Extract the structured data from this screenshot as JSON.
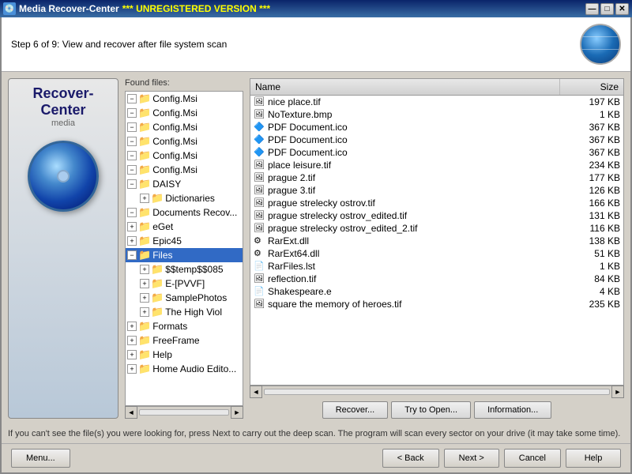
{
  "titleBar": {
    "icon": "💿",
    "appName": "Media Recover-Center",
    "unregistered": "*** UNREGISTERED VERSION ***",
    "minBtn": "—",
    "maxBtn": "□",
    "closeBtn": "✕"
  },
  "stepHeader": {
    "text": "Step 6 of 9: View and recover after file system scan"
  },
  "sidebar": {
    "logoLine1": "Recover-Center",
    "logoLine2": "media"
  },
  "foundFiles": {
    "label": "Found files:"
  },
  "treeItems": [
    {
      "indent": 0,
      "expanded": true,
      "label": "Config.Msi",
      "type": "folder-yellow"
    },
    {
      "indent": 0,
      "expanded": true,
      "label": "Config.Msi",
      "type": "folder-yellow"
    },
    {
      "indent": 0,
      "expanded": true,
      "label": "Config.Msi",
      "type": "folder-yellow"
    },
    {
      "indent": 0,
      "expanded": true,
      "label": "Config.Msi",
      "type": "folder-yellow"
    },
    {
      "indent": 0,
      "expanded": true,
      "label": "Config.Msi",
      "type": "folder-yellow"
    },
    {
      "indent": 0,
      "expanded": true,
      "label": "Config.Msi",
      "type": "folder-yellow"
    },
    {
      "indent": 0,
      "expanded": true,
      "label": "DAISY",
      "type": "folder-yellow"
    },
    {
      "indent": 1,
      "expanded": false,
      "label": "Dictionaries",
      "type": "folder-yellow"
    },
    {
      "indent": 0,
      "expanded": true,
      "label": "Documents Recov...",
      "type": "folder-yellow"
    },
    {
      "indent": 0,
      "expanded": false,
      "label": "eGet",
      "type": "folder-yellow"
    },
    {
      "indent": 0,
      "expanded": false,
      "label": "Epic45",
      "type": "folder-yellow"
    },
    {
      "indent": 0,
      "expanded": true,
      "label": "Files",
      "type": "folder-yellow",
      "selected": true
    },
    {
      "indent": 1,
      "expanded": false,
      "label": "$$temp$$085",
      "type": "folder-yellow"
    },
    {
      "indent": 1,
      "expanded": false,
      "label": "E-[PVVF]",
      "type": "folder-yellow"
    },
    {
      "indent": 1,
      "expanded": false,
      "label": "SamplePhotos",
      "type": "folder-yellow"
    },
    {
      "indent": 1,
      "expanded": false,
      "label": "The High Viol",
      "type": "folder-yellow"
    },
    {
      "indent": 0,
      "expanded": false,
      "label": "Formats",
      "type": "folder-yellow"
    },
    {
      "indent": 0,
      "expanded": false,
      "label": "FreeFrame",
      "type": "folder-yellow"
    },
    {
      "indent": 0,
      "expanded": false,
      "label": "Help",
      "type": "folder-yellow"
    },
    {
      "indent": 0,
      "expanded": false,
      "label": "Home Audio Edito...",
      "type": "folder-yellow"
    }
  ],
  "fileColumns": {
    "name": "Name",
    "size": "Size"
  },
  "files": [
    {
      "name": "nice place.tif",
      "size": "197 KB",
      "type": "tif"
    },
    {
      "name": "NoTexture.bmp",
      "size": "1 KB",
      "type": "bmp"
    },
    {
      "name": "PDF Document.ico",
      "size": "367 KB",
      "type": "ico"
    },
    {
      "name": "PDF Document.ico",
      "size": "367 KB",
      "type": "ico"
    },
    {
      "name": "PDF Document.ico",
      "size": "367 KB",
      "type": "ico"
    },
    {
      "name": "place leisure.tif",
      "size": "234 KB",
      "type": "tif"
    },
    {
      "name": "prague 2.tif",
      "size": "177 KB",
      "type": "tif"
    },
    {
      "name": "prague 3.tif",
      "size": "126 KB",
      "type": "tif"
    },
    {
      "name": "prague strelecky ostrov.tif",
      "size": "166 KB",
      "type": "tif"
    },
    {
      "name": "prague strelecky ostrov_edited.tif",
      "size": "131 KB",
      "type": "tif"
    },
    {
      "name": "prague strelecky ostrov_edited_2.tif",
      "size": "116 KB",
      "type": "tif"
    },
    {
      "name": "RarExt.dll",
      "size": "138 KB",
      "type": "dll"
    },
    {
      "name": "RarExt64.dll",
      "size": "51 KB",
      "type": "dll"
    },
    {
      "name": "RarFiles.lst",
      "size": "1 KB",
      "type": "lst"
    },
    {
      "name": "reflection.tif",
      "size": "84 KB",
      "type": "tif"
    },
    {
      "name": "Shakespeare.e",
      "size": "4 KB",
      "type": "e"
    },
    {
      "name": "square the memory of heroes.tif",
      "size": "235 KB",
      "type": "tif"
    }
  ],
  "actionButtons": {
    "recover": "Recover...",
    "tryOpen": "Try to Open...",
    "information": "Information..."
  },
  "infoText": "If you can't see the file(s) you were looking for, press Next to carry out the deep scan. The program will scan every sector on your drive (it may take some time).",
  "navButtons": {
    "menu": "Menu...",
    "back": "< Back",
    "next": "Next >",
    "cancel": "Cancel",
    "help": "Help"
  }
}
